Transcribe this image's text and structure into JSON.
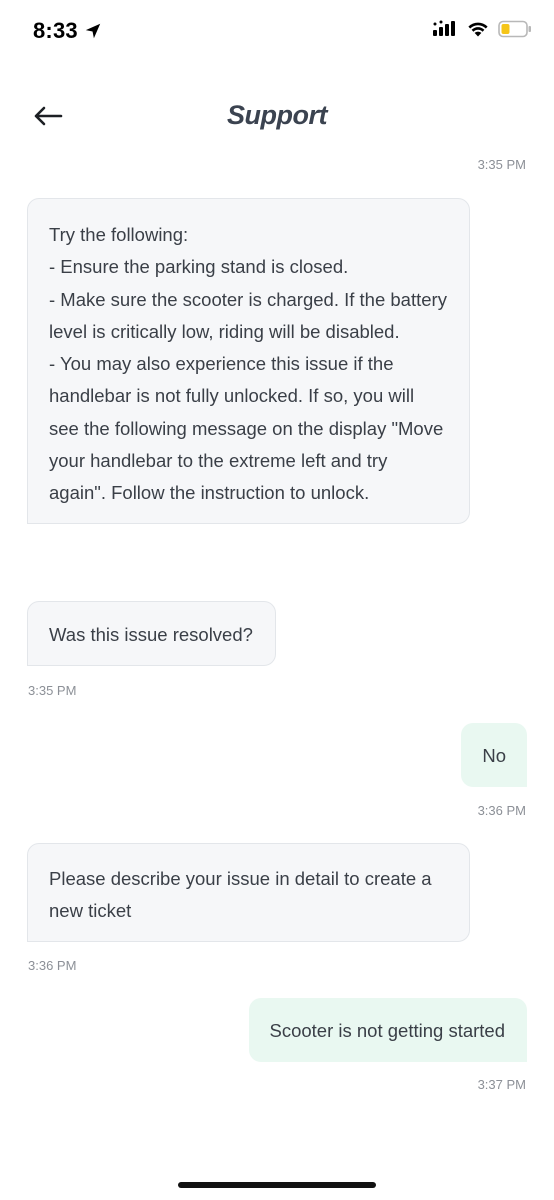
{
  "status_bar": {
    "time": "8:33",
    "icons": [
      "location-arrow-icon",
      "cellular-signal-icon",
      "wifi-icon",
      "battery-low-icon"
    ],
    "battery_color": "#f5c518"
  },
  "header": {
    "back_icon": "arrow-left-icon",
    "title": "Support"
  },
  "conversation": {
    "top_timestamp": "3:35 PM",
    "messages": [
      {
        "sender": "support",
        "text": "Try the following:\n- Ensure the parking stand is closed.\n- Make sure the scooter is charged. If the battery level is critically low, riding will be disabled.\n- You may also experience this issue if the handlebar is not fully unlocked. If so, you will see the following message on the display \"Move your handlebar to the extreme left and try again\". Follow the instruction to unlock."
      },
      {
        "sender": "support",
        "text": "Was this issue resolved?",
        "timestamp": "3:35 PM"
      },
      {
        "sender": "user",
        "text": "No",
        "timestamp": "3:36 PM"
      },
      {
        "sender": "support",
        "text": "Please describe your issue in detail to create a new ticket",
        "timestamp": "3:36 PM"
      },
      {
        "sender": "user",
        "text": "Scooter is not getting started",
        "timestamp": "3:37 PM"
      }
    ]
  },
  "colors": {
    "incoming_bubble": "#f6f7f9",
    "outgoing_bubble": "#e9f8f1",
    "timestamp": "#8c9097",
    "title": "#3b4350"
  }
}
